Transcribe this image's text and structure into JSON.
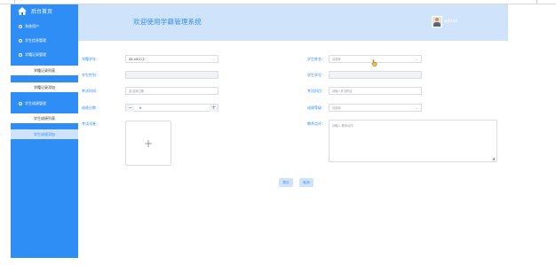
{
  "sidebar": {
    "title": "后台首页",
    "items": [
      {
        "label": "系统用户",
        "kind": "grp"
      },
      {
        "label": "学生信息管理",
        "kind": "grp"
      },
      {
        "label": "学籍记录管理",
        "kind": "grp"
      },
      {
        "label": "学籍记录列表",
        "kind": "sub"
      },
      {
        "label": "学籍记录添加",
        "kind": "sub"
      },
      {
        "label": "学生成绩管理",
        "kind": "grp"
      },
      {
        "label": "学生成绩列表",
        "kind": "sub"
      },
      {
        "label": "学生成绩添加",
        "kind": "sub-active"
      }
    ]
  },
  "header": {
    "title": "欢迎使用学籍管理系统",
    "username": "admin"
  },
  "form": {
    "labels": {
      "academic_year": "学籍学年：",
      "student_name": "学生姓名：",
      "student_gender": "学生性别：",
      "student_id": "学生学号：",
      "exam_time": "考试时间：",
      "exam_subject": "考试科目：",
      "score": "成绩分数：",
      "grade_level": "成绩等级：",
      "exam_paper": "考试试卷：",
      "teacher_comment": "教师点评："
    },
    "values": {
      "academic_year": "XX-1001'(2",
      "student_name_placeholder": "请选择",
      "exam_time_placeholder": "选 选择日期",
      "exam_subject_placeholder": "请输入考试科目",
      "score_value": "0",
      "grade_level_placeholder": "请选择",
      "teacher_comment_placeholder": "请输入 教师点评"
    },
    "upload_plus": "+",
    "buttons": {
      "submit": "提交",
      "reset": "取消"
    },
    "stepper_minus": "−",
    "stepper_plus": "+"
  }
}
